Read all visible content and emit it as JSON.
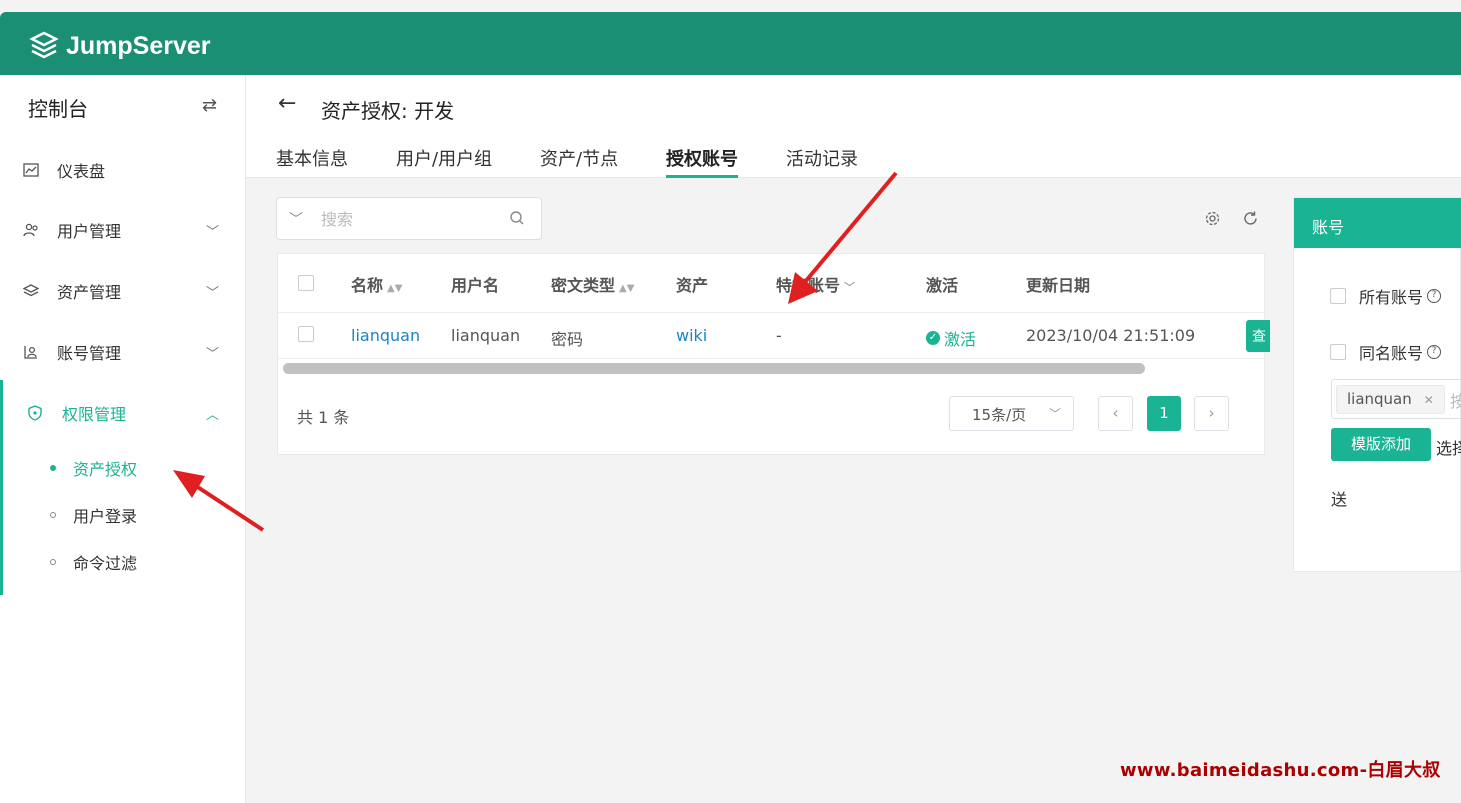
{
  "app": {
    "brand": "JumpServer"
  },
  "sidebar": {
    "console": "控制台",
    "items": [
      {
        "label": "仪表盘",
        "icon": "chart-icon"
      },
      {
        "label": "用户管理",
        "icon": "users-icon"
      },
      {
        "label": "资产管理",
        "icon": "layers-icon"
      },
      {
        "label": "账号管理",
        "icon": "account-icon"
      },
      {
        "label": "权限管理",
        "icon": "shield-icon"
      }
    ],
    "sub_items": [
      {
        "label": "资产授权"
      },
      {
        "label": "用户登录"
      },
      {
        "label": "命令过滤"
      }
    ]
  },
  "header": {
    "title": "资产授权: 开发",
    "tabs": [
      "基本信息",
      "用户/用户组",
      "资产/节点",
      "授权账号",
      "活动记录"
    ]
  },
  "search": {
    "placeholder": "搜索"
  },
  "table": {
    "columns": [
      "名称",
      "用户名",
      "密文类型",
      "资产",
      "特权账号",
      "激活",
      "更新日期"
    ],
    "rows": [
      {
        "name": "lianquan",
        "username": "lianquan",
        "secret_type": "密码",
        "asset": "wiki",
        "privileged": "-",
        "active": "激活",
        "updated": "2023/10/04 21:51:09",
        "action": "查"
      }
    ],
    "total": "共 1 条",
    "page_size": "15条/页",
    "current_page": "1"
  },
  "panel": {
    "title": "账号",
    "all_accounts": "所有账号",
    "same_name": "同名账号",
    "tag": "lianquan",
    "tag_placeholder": "按",
    "template_button": "模版添加",
    "choose": "选择",
    "send": "送"
  },
  "watermark": "www.baimeidashu.com-白眉大叔",
  "colors": {
    "brand": "#1a8f73",
    "accent": "#1ab394",
    "link": "#1c84c6",
    "annotation": "#e02020"
  }
}
